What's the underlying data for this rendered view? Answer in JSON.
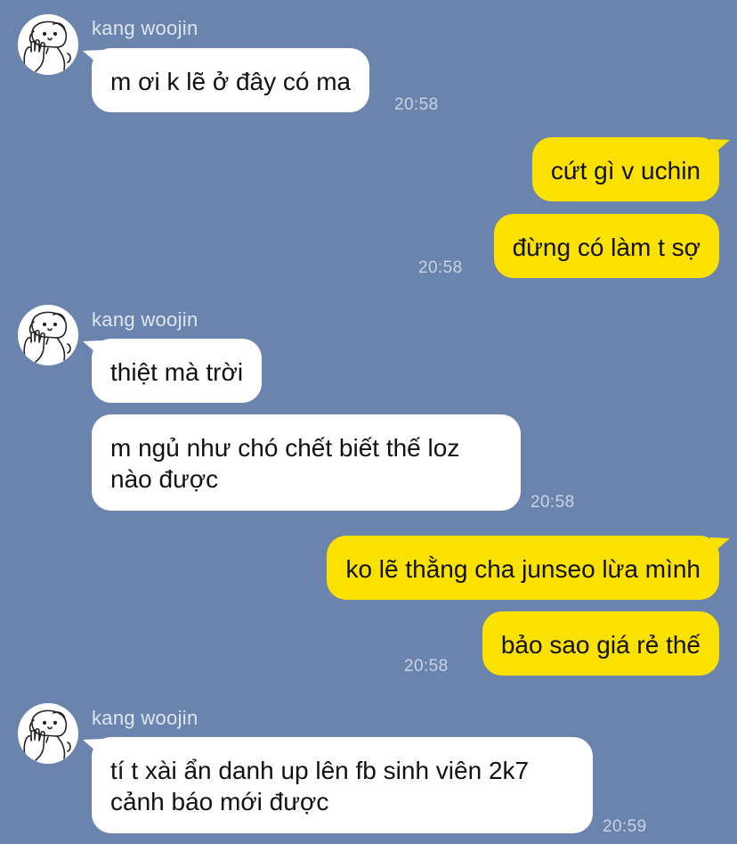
{
  "messages": [
    {
      "sender": "kang woojin",
      "text": "m ơi k lẽ ở đây có ma",
      "time": "20:58"
    },
    {
      "text": "cứt gì v uchin"
    },
    {
      "text": "đừng có làm t sợ",
      "time": "20:58"
    },
    {
      "sender": "kang woojin",
      "text": "thiệt mà trời"
    },
    {
      "text": "m ngủ như chó chết biết thế loz nào được",
      "time": "20:58"
    },
    {
      "text": "ko lẽ thằng cha junseo lừa mình"
    },
    {
      "text": "bảo sao giá rẻ thế",
      "time": "20:58"
    },
    {
      "sender": "kang woojin",
      "text": "tí t xài ẩn danh up lên fb sinh viên 2k7 cảnh báo mới được",
      "time": "20:59"
    }
  ],
  "colors": {
    "background": "#6b84ad",
    "incoming_bubble": "#ffffff",
    "outgoing_bubble": "#fae100"
  },
  "icons": {
    "avatar": "dog-avatar-icon"
  }
}
